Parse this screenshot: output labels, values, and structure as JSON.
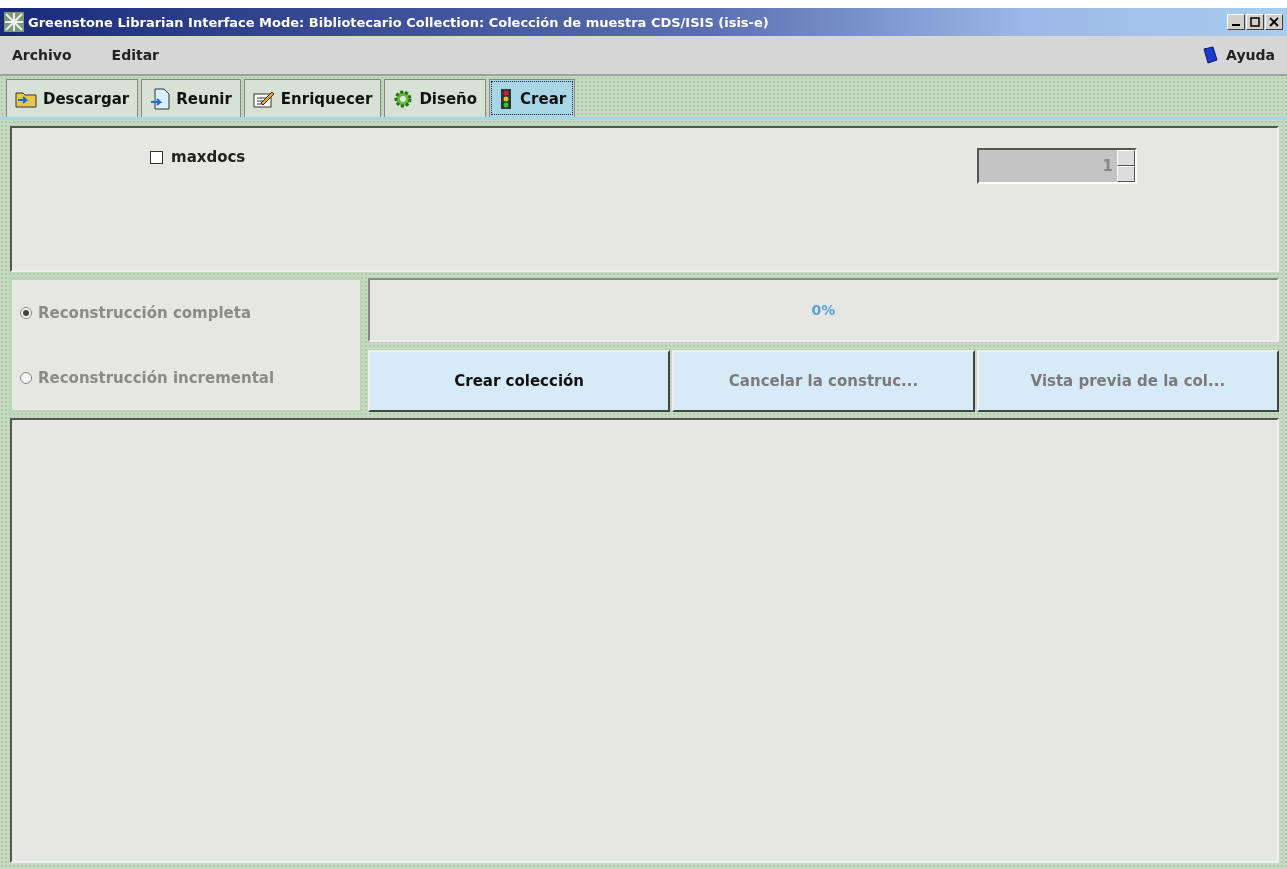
{
  "window": {
    "title": "Greenstone Librarian Interface  Mode: Bibliotecario  Collection: Colección de muestra CDS/ISIS (isis-e)"
  },
  "menu": {
    "items": [
      {
        "label": "Archivo"
      },
      {
        "label": "Editar"
      }
    ],
    "help": {
      "label": "Ayuda"
    }
  },
  "tabs": [
    {
      "label": "Descargar",
      "kind": "download",
      "selected": false
    },
    {
      "label": "Reunir",
      "kind": "gather",
      "selected": false
    },
    {
      "label": "Enriquecer",
      "kind": "enrich",
      "selected": false
    },
    {
      "label": "Diseño",
      "kind": "design",
      "selected": false
    },
    {
      "label": "Crear",
      "kind": "create",
      "selected": true
    }
  ],
  "options": {
    "maxdocs": {
      "label": "maxdocs",
      "checked": false
    },
    "spinner": {
      "value": "1",
      "disabled": true
    }
  },
  "build_type": [
    {
      "label": "Reconstrucción completa",
      "selected": true,
      "disabled": true
    },
    {
      "label": "Reconstrucción incremental",
      "selected": false,
      "disabled": true
    }
  ],
  "progress": {
    "level": 0,
    "reading": "0%"
  },
  "buttons": [
    {
      "label": "Crear colección",
      "disabled": false
    },
    {
      "label": "Cancelar la construc...",
      "disabled": true
    },
    {
      "label": "Vista previa de la col...",
      "disabled": true
    }
  ]
}
